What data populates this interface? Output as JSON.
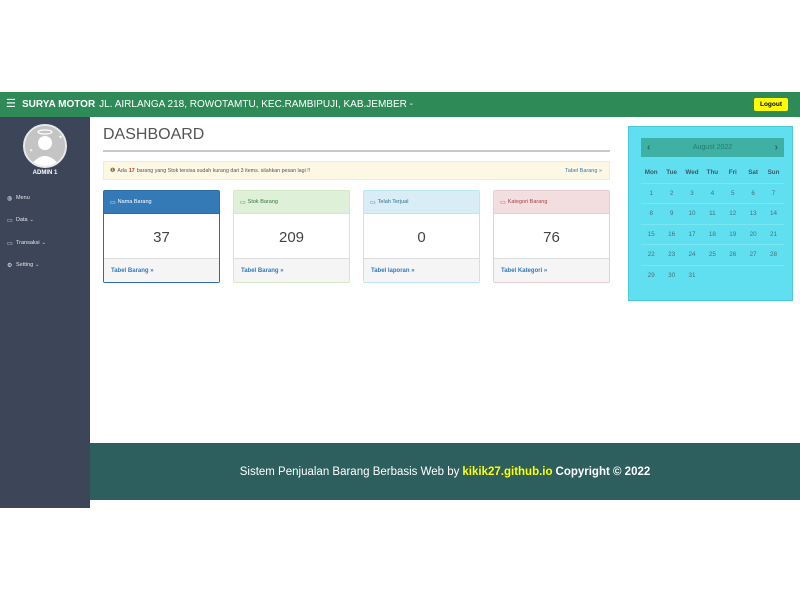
{
  "topbar": {
    "brand": "SURYA MOTOR",
    "address": "JL. AIRLANGA 218, ROWOTAMTU, KEC.RAMBIPUJI, KAB.JEMBER -",
    "logout_label": "Logout",
    "colors": {
      "bar": "#2e8b57",
      "logout": "#ffff00"
    }
  },
  "sidebar": {
    "user_name": "ADMIN 1",
    "items": [
      {
        "label": "Menu",
        "icon": "dashboard-icon",
        "has_submenu": false
      },
      {
        "label": "Data",
        "icon": "desktop-icon",
        "has_submenu": true
      },
      {
        "label": "Transaksi",
        "icon": "desktop-icon",
        "has_submenu": true
      },
      {
        "label": "Setting",
        "icon": "gear-icon",
        "has_submenu": true
      }
    ]
  },
  "main": {
    "title": "DASHBOARD",
    "alert": {
      "prefix": "Ada",
      "count": "17",
      "text": "barang yang Stok tersisa sudah kurang dari 3 items. silahkan pesan lagi !!",
      "link": "Tabel Barang »"
    },
    "panels": [
      {
        "title": "Nama Barang",
        "value": "37",
        "link": "Tabel Barang »"
      },
      {
        "title": "Stok Barang",
        "value": "209",
        "link": "Tabel Barang »"
      },
      {
        "title": "Telah Terjual",
        "value": "0",
        "link": "Tabel laporan »"
      },
      {
        "title": "Kategori Barang",
        "value": "76",
        "link": "Tabel Kategori »"
      }
    ]
  },
  "calendar": {
    "month": "August 2022",
    "prev": "‹",
    "next": "›",
    "weekdays": [
      "Mon",
      "Tue",
      "Wed",
      "Thu",
      "Fri",
      "Sat",
      "Sun"
    ],
    "weeks": [
      [
        "1",
        "2",
        "3",
        "4",
        "5",
        "6",
        "7"
      ],
      [
        "8",
        "9",
        "10",
        "11",
        "12",
        "13",
        "14"
      ],
      [
        "15",
        "16",
        "17",
        "18",
        "19",
        "20",
        "21"
      ],
      [
        "22",
        "23",
        "24",
        "25",
        "26",
        "27",
        "28"
      ],
      [
        "29",
        "30",
        "31",
        "",
        "",
        "",
        ""
      ]
    ]
  },
  "footer": {
    "text": "Sistem Penjualan Barang Berbasis Web by",
    "link": "kikik27.github.io",
    "copyright": "Copyright © 2022"
  }
}
